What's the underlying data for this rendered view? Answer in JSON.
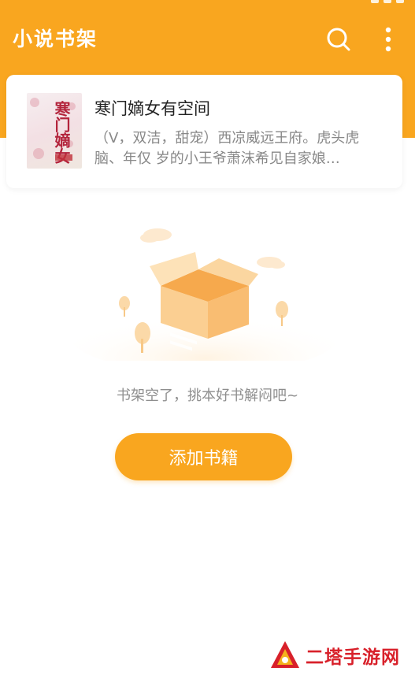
{
  "app": {
    "title": "小说书架"
  },
  "toolbar": {
    "search_icon": "search-icon",
    "menu_icon": "more-vertical-icon"
  },
  "bookshelf": {
    "books": [
      {
        "title": "寒门嫡女有空间",
        "description": "（V，双洁，甜宠）西凉威远王府。虎头虎脑、年仅 岁的小王爷萧沫希见自家娘…",
        "cover_text": "寒门嫡女"
      }
    ]
  },
  "empty_state": {
    "message": "书架空了，挑本好书解闷吧~",
    "button_label": "添加书籍"
  },
  "watermark": {
    "text": "二塔手游网"
  },
  "colors": {
    "accent": "#f9a61f",
    "watermark": "#d8202a",
    "muted_text": "#8e8e8e"
  }
}
